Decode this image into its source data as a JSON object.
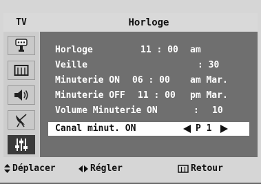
{
  "header": {
    "source_label": "TV",
    "title": "Horloge"
  },
  "sidebar": {
    "items": [
      {
        "icon": "input-plug-icon"
      },
      {
        "icon": "picture-grid-icon"
      },
      {
        "icon": "speaker-icon"
      },
      {
        "icon": "antenna-dish-icon"
      },
      {
        "icon": "setup-sliders-icon",
        "active": true
      }
    ]
  },
  "menu": {
    "rows": [
      {
        "label": "Horloge",
        "value1": "11 : 00",
        "value2": "am"
      },
      {
        "label": "Veille",
        "value1": ": 30"
      },
      {
        "label": "Minuterie ON",
        "value1": "06 : 00",
        "value2": "am Mar."
      },
      {
        "label": "Minuterie OFF",
        "value1": "11 : 00",
        "value2": "pm Mar."
      },
      {
        "label": "Volume Minuterie ON",
        "value1": ":",
        "value2": "10"
      },
      {
        "label": "Canal minut. ON",
        "value1": "P 1",
        "selected": true
      }
    ]
  },
  "footer": {
    "move_label": "Déplacer",
    "adjust_label": "Régler",
    "return_label": "Retour"
  },
  "colors": {
    "panel": "#6f6f6f",
    "frame": "#d6d6d6",
    "text": "#ffffff",
    "selected_bg": "#ffffff"
  }
}
